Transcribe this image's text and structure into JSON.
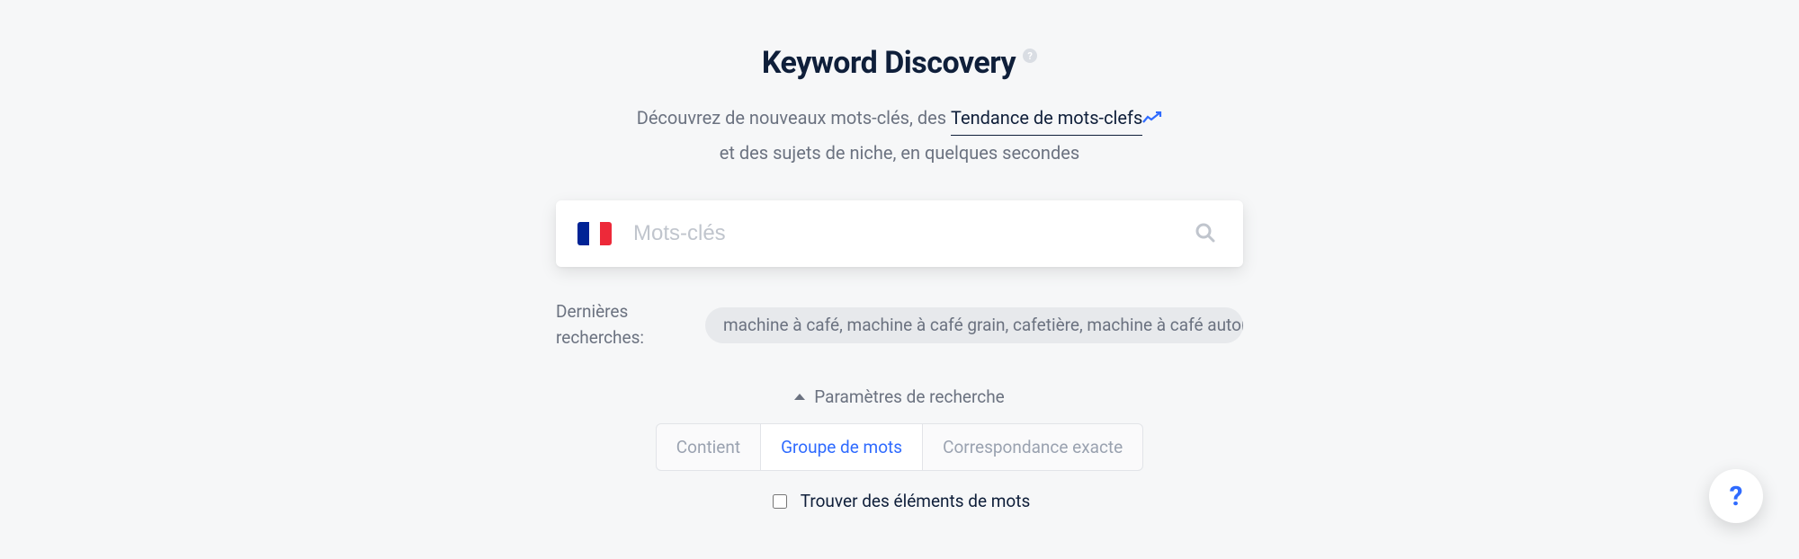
{
  "header": {
    "title": "Keyword Discovery",
    "subtitle_pre": "Découvrez de nouveaux mots-clés, des ",
    "trend_link": "Tendance de mots-clefs",
    "subtitle_post": "et des sujets de niche, en quelques secondes"
  },
  "search": {
    "placeholder": "Mots-clés",
    "value": "",
    "locale_flag": "fr"
  },
  "recent": {
    "label": "Dernières recherches:",
    "item": "machine à café, machine à café grain, cafetière, machine à café autor"
  },
  "params": {
    "toggle_label": "Paramètres de recherche",
    "tabs": [
      {
        "label": "Contient",
        "active": false
      },
      {
        "label": "Groupe de mots",
        "active": true
      },
      {
        "label": "Correspondance exacte",
        "active": false
      }
    ],
    "word_elements_label": "Trouver des éléments de mots",
    "word_elements_checked": false
  },
  "fab": {
    "glyph": "?"
  }
}
